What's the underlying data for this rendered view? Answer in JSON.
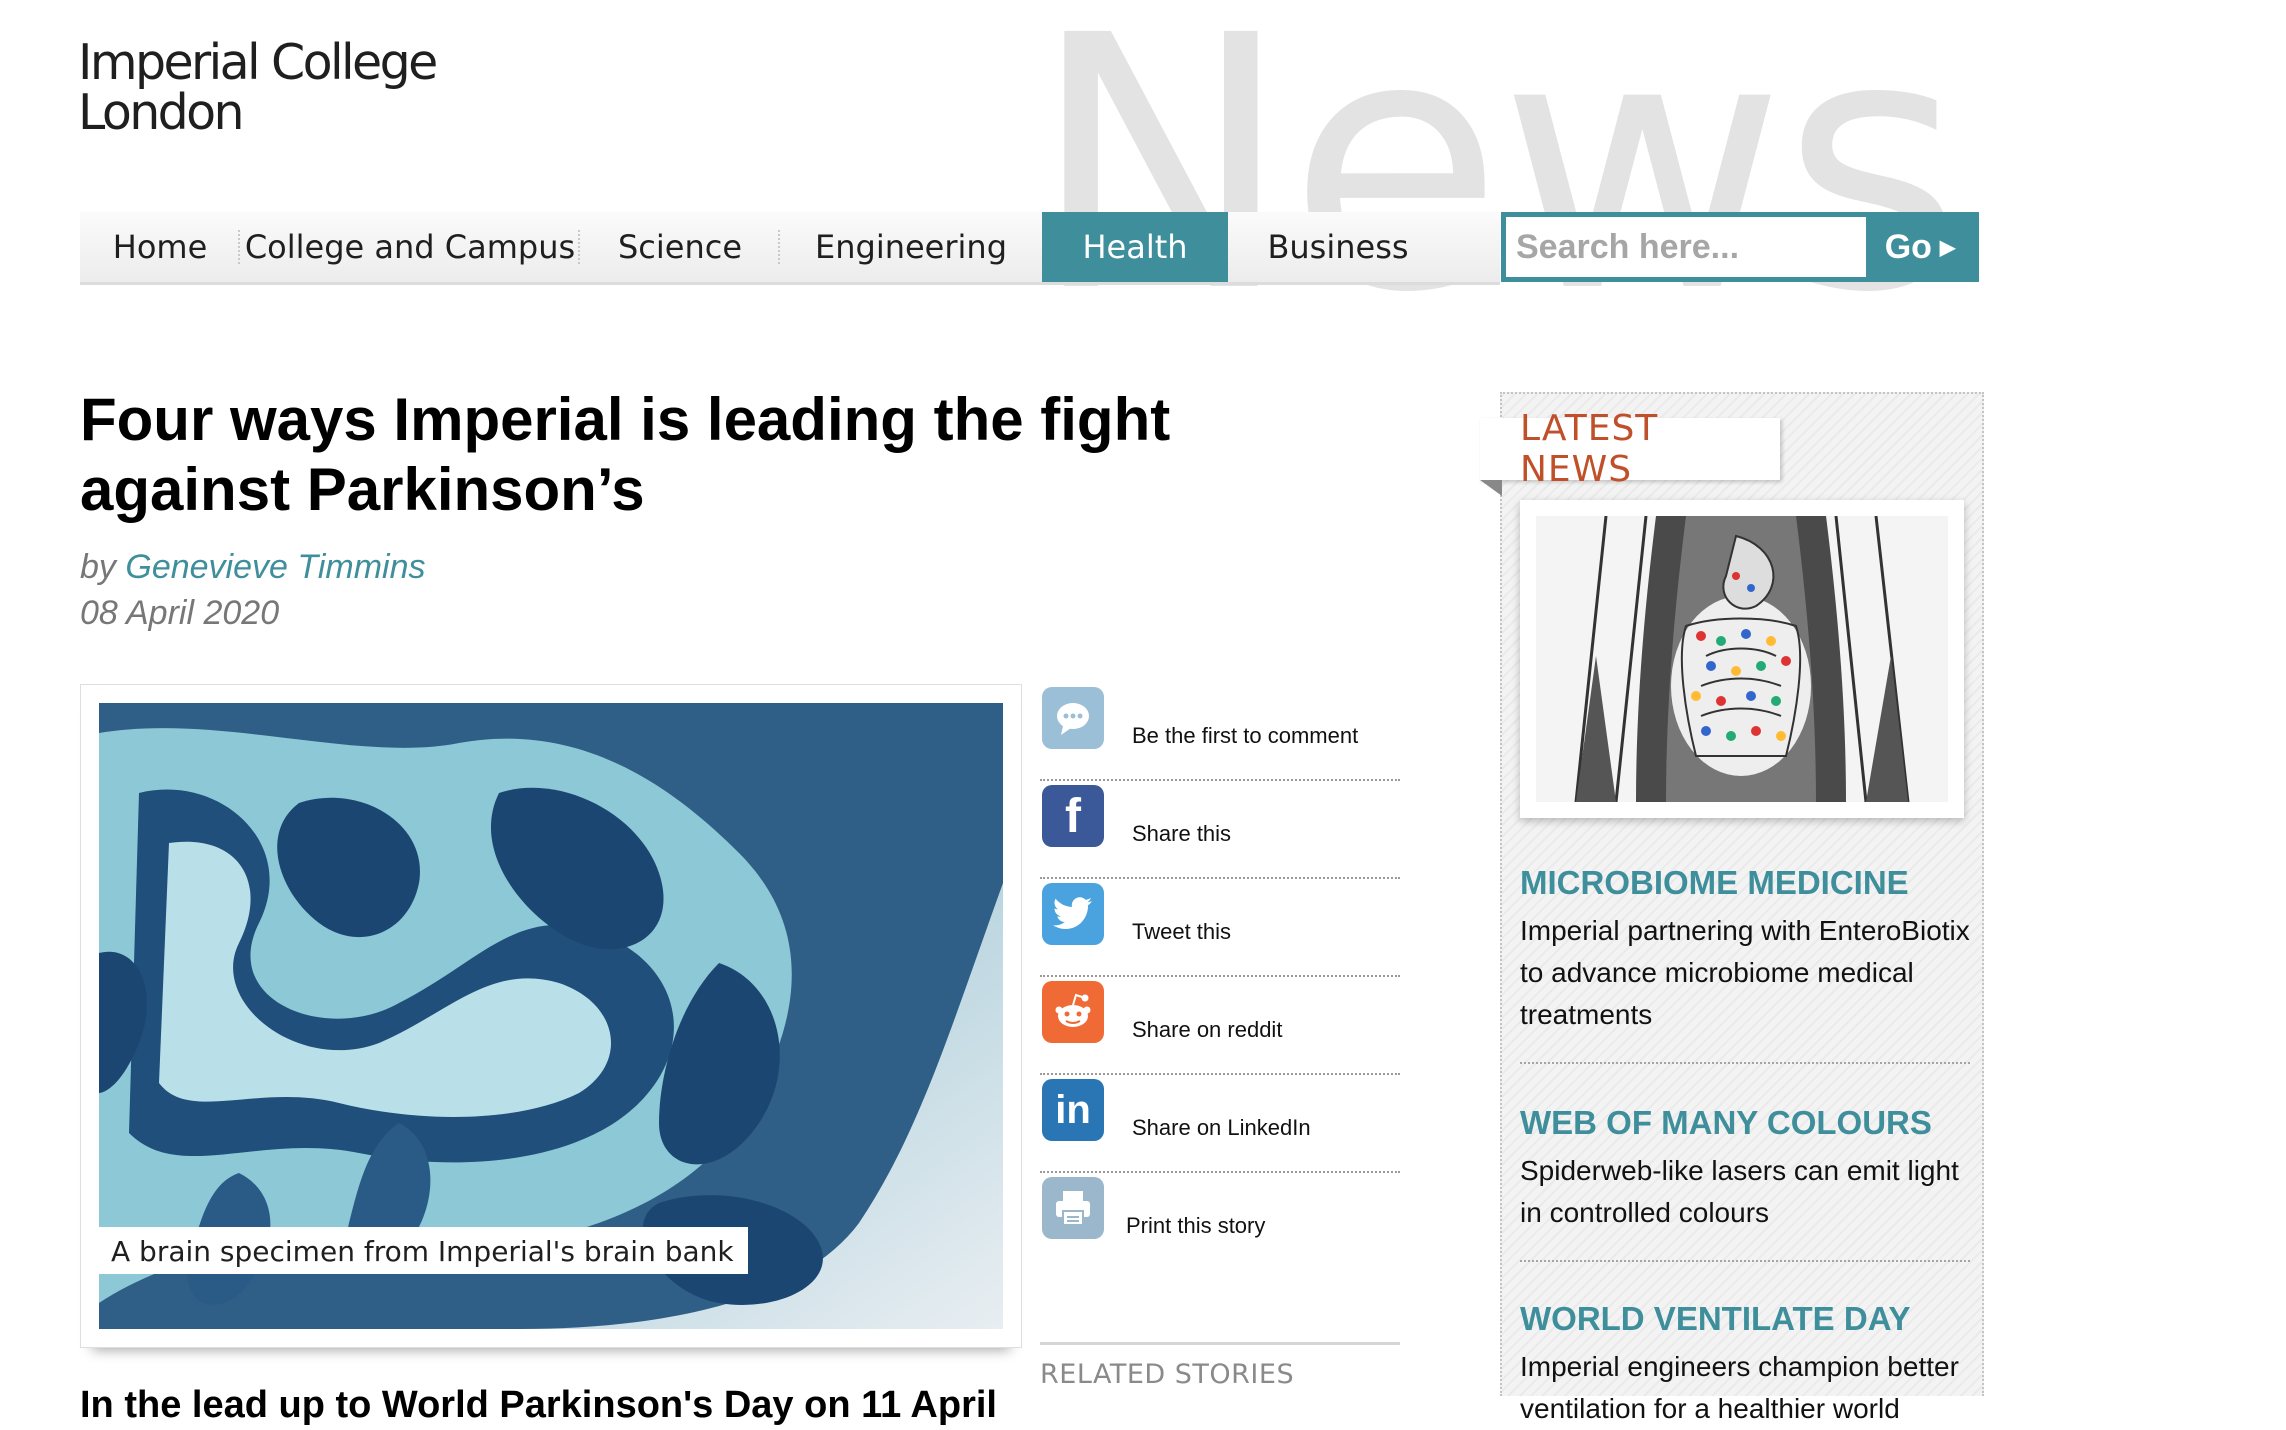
{
  "header": {
    "watermark": "News",
    "logo_line1": "Imperial College",
    "logo_line2": "London"
  },
  "nav": {
    "items": [
      {
        "label": "Home"
      },
      {
        "label": "College and Campus"
      },
      {
        "label": "Science"
      },
      {
        "label": "Engineering"
      },
      {
        "label": "Health",
        "active": true
      },
      {
        "label": "Business"
      }
    ],
    "active_color": "#3e8f9b"
  },
  "search": {
    "placeholder": "Search here...",
    "go_label": "Go"
  },
  "article": {
    "title": "Four ways Imperial is leading the fight against Parkinson’s",
    "by": "by",
    "author": "Genevieve Timmins",
    "date": "08 April 2020",
    "image_caption": "A brain specimen from Imperial's brain bank",
    "intro_partial": "In the lead up to World Parkinson's Day on 11 April"
  },
  "share": {
    "items": [
      {
        "label": "Be the first to comment",
        "icon": "comment-icon",
        "color": "#9bbfd6"
      },
      {
        "label": "Share this",
        "icon": "facebook-icon",
        "color": "#3b5998"
      },
      {
        "label": "Tweet this",
        "icon": "twitter-icon",
        "color": "#4aa3df"
      },
      {
        "label": "Share on reddit",
        "icon": "reddit-icon",
        "color": "#f06a35"
      },
      {
        "label": "Share on LinkedIn",
        "icon": "linkedin-icon",
        "color": "#2a76b5"
      },
      {
        "label": "Print this story",
        "icon": "print-icon",
        "color": "#9ab7cc"
      }
    ],
    "related_heading": "RELATED STORIES"
  },
  "sidebar": {
    "heading": "LATEST NEWS",
    "heading_color": "#c0502a",
    "items": [
      {
        "title": "MICROBIOME MEDICINE",
        "text": "Imperial partnering with EnteroBiotix to advance microbiome medical treatments"
      },
      {
        "title": "WEB OF MANY COLOURS",
        "text": "Spiderweb-like lasers can emit light in controlled colours"
      },
      {
        "title": "WORLD VENTILATE DAY",
        "text": "Imperial engineers champion better ventilation for a healthier world"
      }
    ]
  }
}
